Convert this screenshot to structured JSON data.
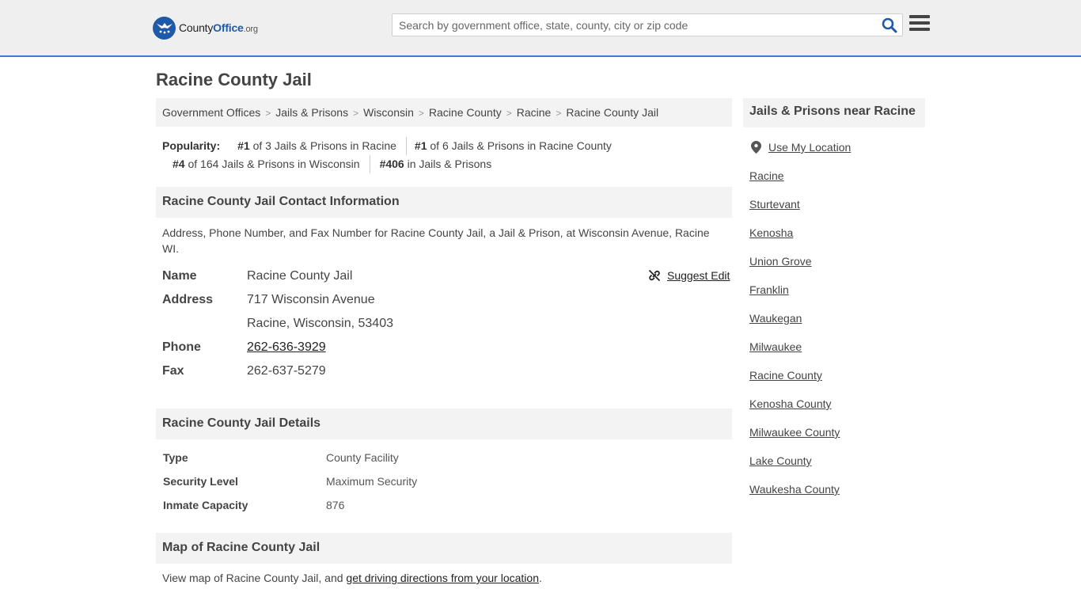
{
  "header": {
    "logo": {
      "brand_county": "County",
      "brand_office": "Office",
      "brand_tld": ".org"
    },
    "search": {
      "placeholder": "Search by government office, state, county, city or zip code"
    },
    "icons": {
      "search": "search-icon",
      "menu": "hamburger-menu-icon",
      "logo": "eagle-stars-icon"
    },
    "accent_color": "#3d7ec9"
  },
  "page": {
    "title": "Racine County Jail"
  },
  "breadcrumb": [
    "Government Offices",
    "Jails & Prisons",
    "Wisconsin",
    "Racine County",
    "Racine",
    "Racine County Jail"
  ],
  "popularity": {
    "label": "Popularity:",
    "items": [
      {
        "rank": "#1",
        "text": "of 3 Jails & Prisons in Racine"
      },
      {
        "rank": "#1",
        "text": "of 6 Jails & Prisons in Racine County"
      },
      {
        "rank": "#4",
        "text": "of 164 Jails & Prisons in Wisconsin"
      },
      {
        "rank": "#406",
        "text": "in Jails & Prisons"
      }
    ]
  },
  "contact": {
    "heading": "Racine County Jail Contact Information",
    "description": "Address, Phone Number, and Fax Number for Racine County Jail, a Jail & Prison, at Wisconsin Avenue, Racine WI.",
    "suggest_edit": "Suggest Edit",
    "name_label": "Name",
    "name": "Racine County Jail",
    "address_label": "Address",
    "address_line1": "717 Wisconsin Avenue",
    "address_line2": "Racine, Wisconsin, 53403",
    "phone_label": "Phone",
    "phone": "262-636-3929",
    "fax_label": "Fax",
    "fax": "262-637-5279"
  },
  "details": {
    "heading": "Racine County Jail Details",
    "rows": [
      {
        "label": "Type",
        "value": "County Facility"
      },
      {
        "label": "Security Level",
        "value": "Maximum Security"
      },
      {
        "label": "Inmate Capacity",
        "value": "876"
      }
    ]
  },
  "map": {
    "heading": "Map of Racine County Jail",
    "text_before": "View map of Racine County Jail, and ",
    "link": "get driving directions from your location",
    "text_after": "."
  },
  "sidebar": {
    "heading": "Jails & Prisons near Racine",
    "use_location": "Use My Location",
    "links": [
      "Racine",
      "Sturtevant",
      "Kenosha",
      "Union Grove",
      "Franklin",
      "Waukegan",
      "Milwaukee",
      "Racine County",
      "Kenosha County",
      "Milwaukee County",
      "Lake County",
      "Waukesha County"
    ]
  }
}
